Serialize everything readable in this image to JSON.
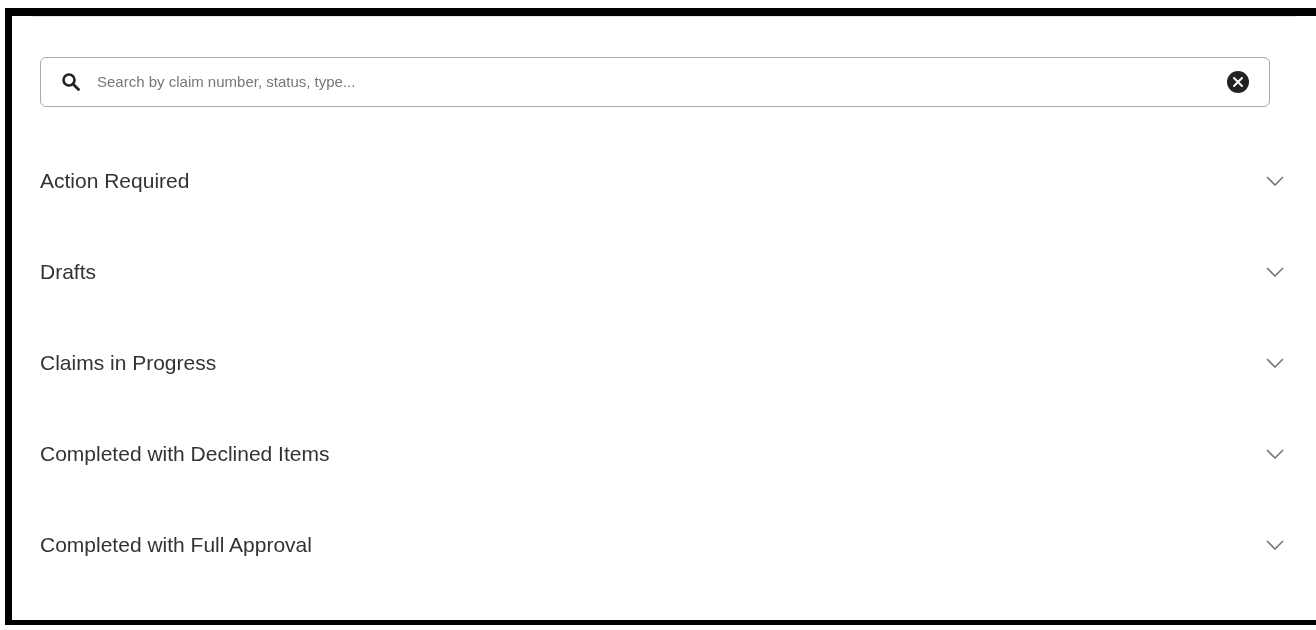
{
  "search": {
    "placeholder": "Search by claim number, status, type..."
  },
  "sections": [
    {
      "title": "Action Required",
      "expanded": false
    },
    {
      "title": "Drafts",
      "expanded": false
    },
    {
      "title": "Claims in Progress",
      "expanded": false
    },
    {
      "title": "Completed with Declined Items",
      "expanded": false
    },
    {
      "title": "Completed with Full Approval",
      "expanded": false
    }
  ]
}
